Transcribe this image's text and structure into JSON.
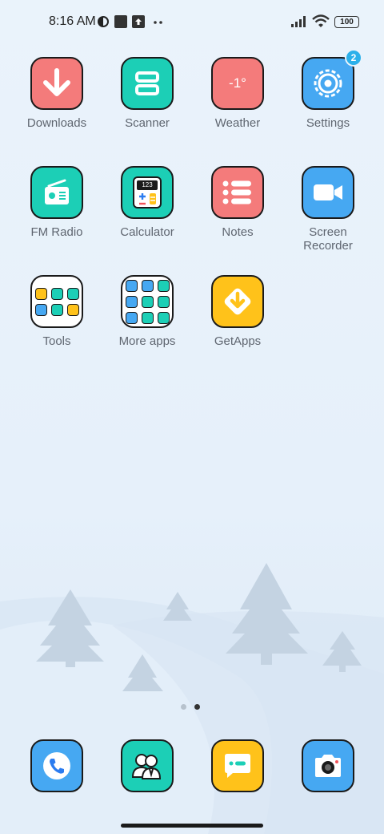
{
  "status_bar": {
    "time": "8:16 AM",
    "battery": "100"
  },
  "apps": [
    {
      "name": "Downloads",
      "color": "#f47b7b"
    },
    {
      "name": "Scanner",
      "color": "#1ccfb6"
    },
    {
      "name": "Weather",
      "color": "#f47b7b",
      "temperature": "-1°"
    },
    {
      "name": "Settings",
      "color": "#46a8f2",
      "badge": "2"
    },
    {
      "name": "FM Radio",
      "color": "#1ccfb6"
    },
    {
      "name": "Calculator",
      "color": "#1ccfb6",
      "display": "123"
    },
    {
      "name": "Notes",
      "color": "#f47b7b"
    },
    {
      "name": "Screen\nRecorder",
      "color": "#46a8f2"
    },
    {
      "name": "Tools",
      "color": "#ffffff"
    },
    {
      "name": "More apps",
      "color": "#ffffff"
    },
    {
      "name": "GetApps",
      "color": "#ffc21a"
    }
  ],
  "dock": [
    {
      "name": "phone-icon",
      "color": "#46a8f2"
    },
    {
      "name": "contacts-icon",
      "color": "#1ccfb6"
    },
    {
      "name": "messaging-icon",
      "color": "#ffc21a"
    },
    {
      "name": "camera-icon",
      "color": "#46a8f2"
    }
  ],
  "page_indicator": {
    "pages": 2,
    "current": 2
  }
}
